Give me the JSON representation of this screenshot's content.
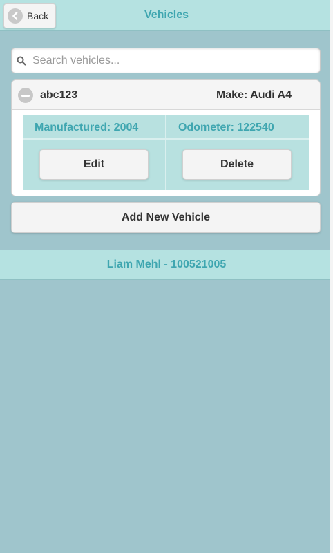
{
  "header": {
    "back_label": "Back",
    "title": "Vehicles"
  },
  "search": {
    "placeholder": "Search vehicles...",
    "value": ""
  },
  "vehicle": {
    "plate": "abc123",
    "make": "Make: Audi A4",
    "manufactured": "Manufactured: 2004",
    "odometer": "Odometer: 122540",
    "edit_label": "Edit",
    "delete_label": "Delete"
  },
  "add_label": "Add New Vehicle",
  "footer": {
    "text": "Liam Mehl - 100521005"
  },
  "colors": {
    "background": "#9fc5cc",
    "header": "#b5e2e1",
    "accent": "#3fa6b0"
  },
  "icons": [
    "back-arrow-icon",
    "search-icon",
    "collapse-minus-icon"
  ]
}
